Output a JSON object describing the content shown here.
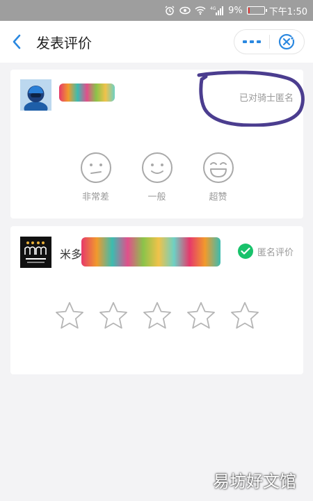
{
  "status_bar": {
    "battery_percent": "9%",
    "time": "下午1:50",
    "network": "4G",
    "icons": [
      "alarm-icon",
      "eye-icon",
      "wifi-icon",
      "signal-icon",
      "battery-icon"
    ],
    "battery_level": 0.09
  },
  "header": {
    "back_icon": "chevron-left-icon",
    "title": "发表评价",
    "more_icon": "more-dots-icon",
    "close_icon": "close-target-icon"
  },
  "rider_card": {
    "anonymous_label": "已对骑士匿名",
    "ratings": [
      {
        "label": "非常差",
        "icon": "face-meh-icon"
      },
      {
        "label": "一般",
        "icon": "face-smile-icon"
      },
      {
        "label": "超赞",
        "icon": "face-laugh-icon"
      }
    ]
  },
  "shop_card": {
    "shop_name_visible": "米多",
    "anonymous_label": "匿名评价",
    "anonymous_checked": true,
    "star_count": 5,
    "selected_stars": 0
  },
  "watermark": "易坊好文馆",
  "colors": {
    "accent_blue": "#2a88e0",
    "check_green": "#18c26b",
    "annotation_purple": "#4b3d8f",
    "background": "#f3f3f5"
  }
}
